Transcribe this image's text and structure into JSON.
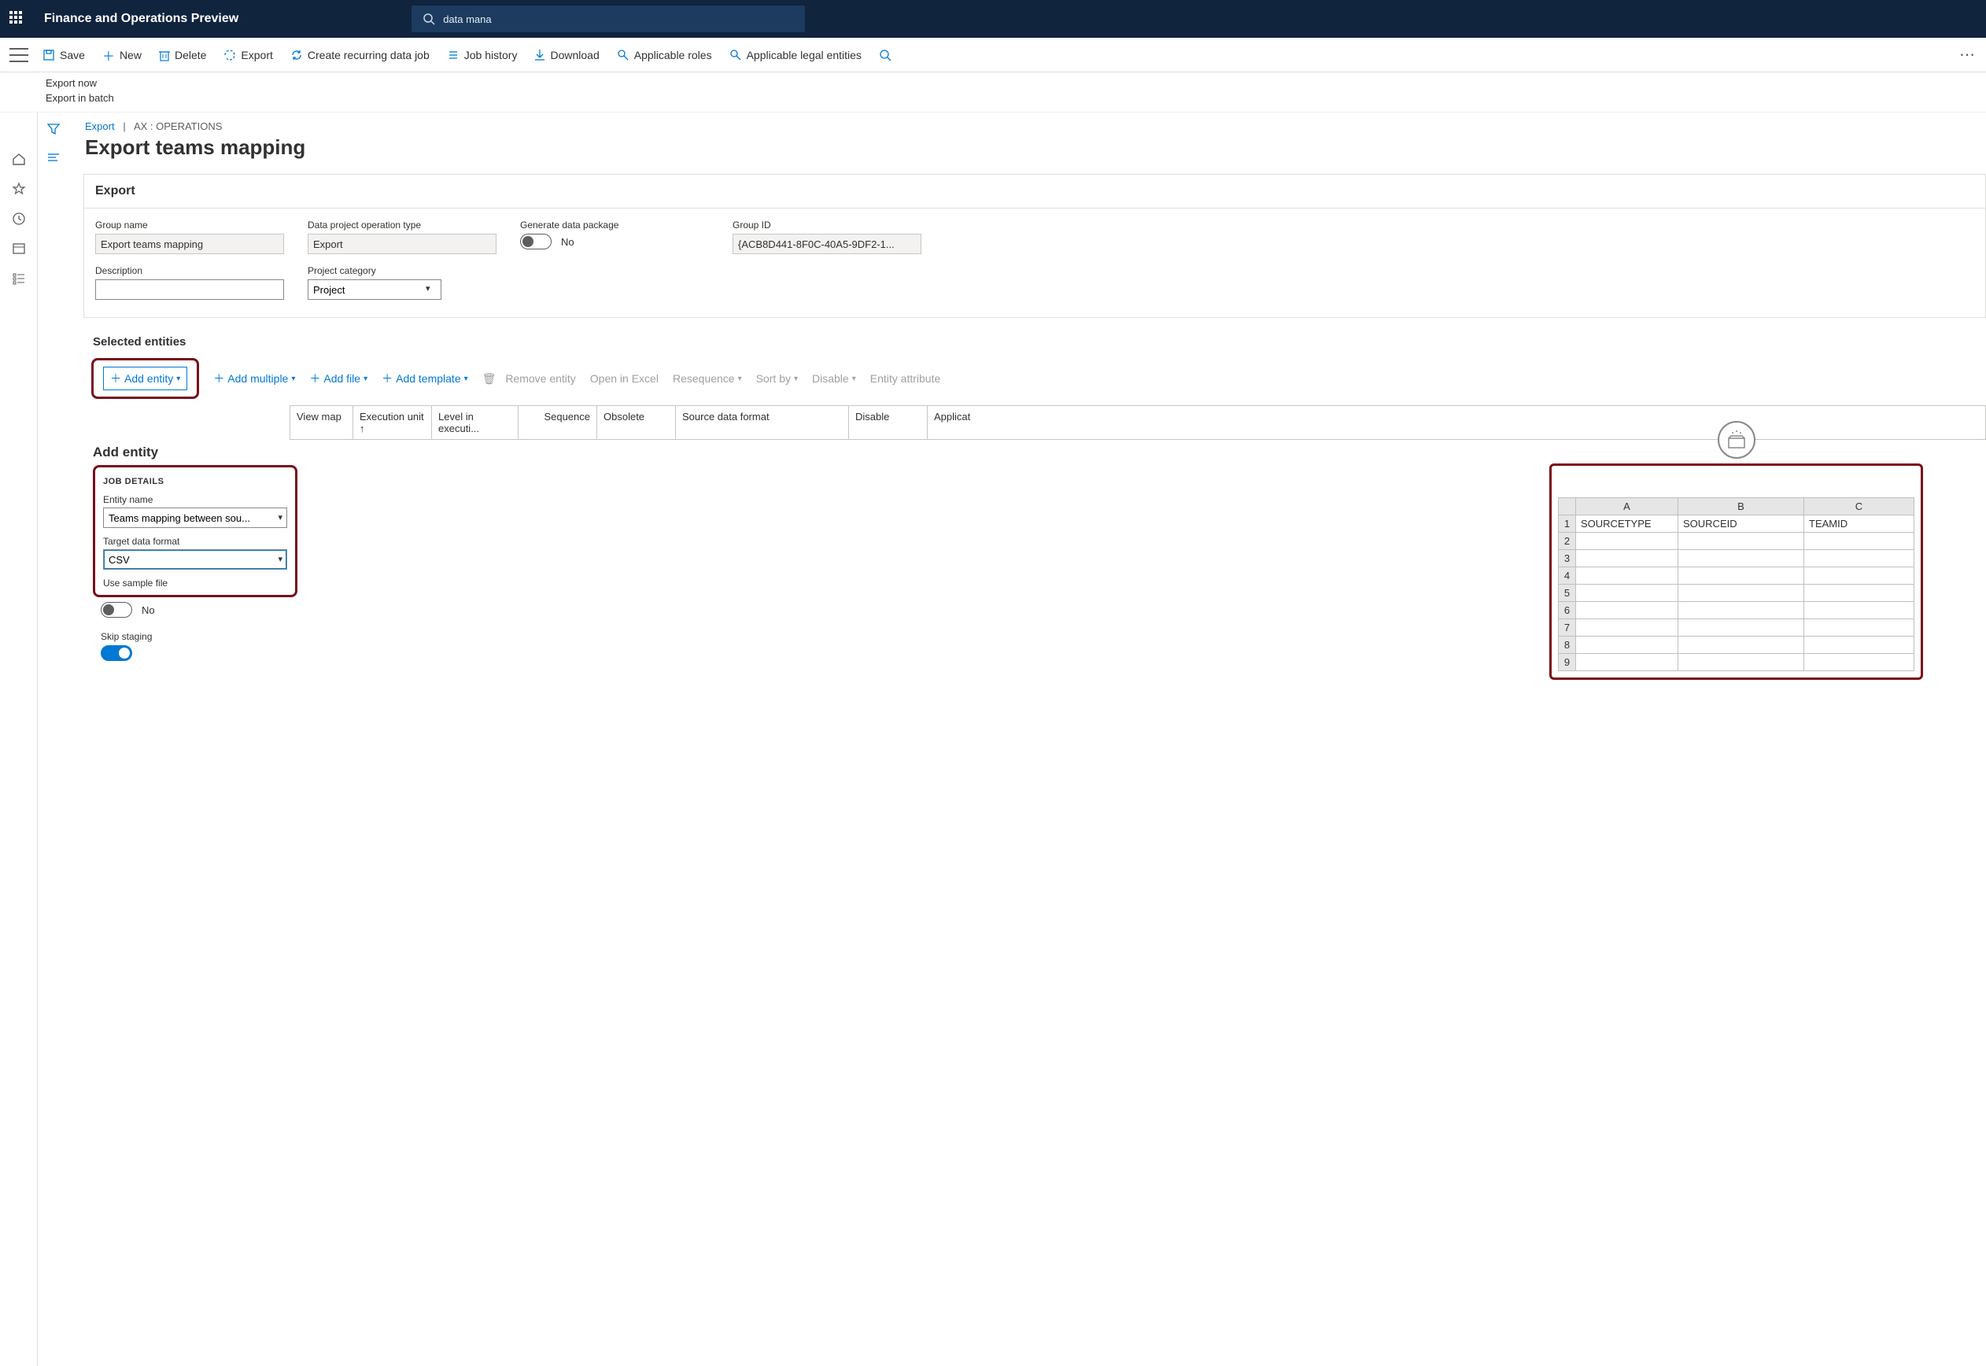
{
  "header": {
    "appTitle": "Finance and Operations Preview",
    "searchText": "data mana"
  },
  "actions": {
    "save": "Save",
    "new": "New",
    "delete": "Delete",
    "export": "Export",
    "recurring": "Create recurring data job",
    "jobHistory": "Job history",
    "download": "Download",
    "applicableRoles": "Applicable roles",
    "applicableLegalEntities": "Applicable legal entities"
  },
  "subActions": {
    "exportNow": "Export now",
    "exportBatch": "Export in batch"
  },
  "breadcrumb": {
    "link": "Export",
    "sep": "|",
    "rest": "AX : OPERATIONS"
  },
  "pageTitle": "Export teams mapping",
  "exportCard": {
    "title": "Export",
    "groupNameLabel": "Group name",
    "groupName": "Export teams mapping",
    "opTypeLabel": "Data project operation type",
    "opType": "Export",
    "genPkgLabel": "Generate data package",
    "genPkgValue": "No",
    "groupIdLabel": "Group ID",
    "groupId": "{ACB8D441-8F0C-40A5-9DF2-1...",
    "descLabel": "Description",
    "desc": "",
    "projCatLabel": "Project category",
    "projCat": "Project"
  },
  "selectedEntitiesTitle": "Selected entities",
  "entityToolbar": {
    "addEntity": "Add entity",
    "addMultiple": "Add multiple",
    "addFile": "Add file",
    "addTemplate": "Add template",
    "removeEntity": "Remove entity",
    "openExcel": "Open in Excel",
    "resequence": "Resequence",
    "sortBy": "Sort by",
    "disable": "Disable",
    "entityAttribute": "Entity attribute"
  },
  "gridColumns": [
    "View map",
    "Execution unit",
    "Level in executi...",
    "Sequence",
    "Obsolete",
    "Source data format",
    "Disable",
    "Applicat"
  ],
  "addEntityPanel": {
    "title": "Add entity",
    "jobDetails": "JOB DETAILS",
    "entityNameLabel": "Entity name",
    "entityName": "Teams mapping between sou...",
    "targetFormatLabel": "Target data format",
    "targetFormat": "CSV",
    "useSampleLabel": "Use sample file",
    "useSample": "No",
    "skipStagingLabel": "Skip staging"
  },
  "sheet": {
    "cols": [
      "A",
      "B",
      "C"
    ],
    "row1": [
      "SOURCETYPE",
      "SOURCEID",
      "TEAMID"
    ],
    "rowCount": 9
  }
}
